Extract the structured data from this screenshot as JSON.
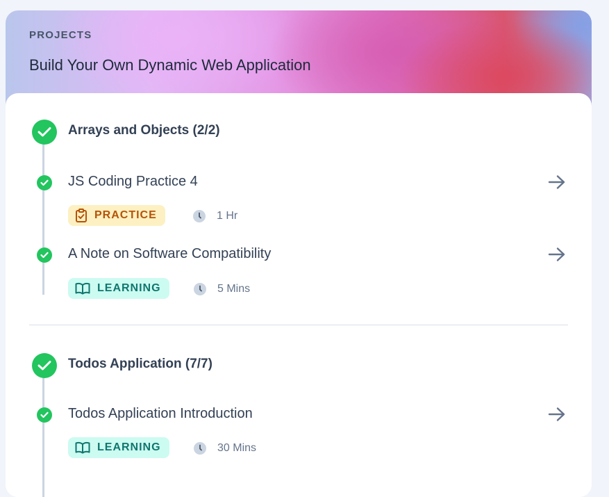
{
  "header": {
    "eyebrow": "PROJECTS",
    "title": "Build Your Own Dynamic Web Application"
  },
  "sections": [
    {
      "title": "Arrays and Objects (2/2)",
      "items": [
        {
          "title": "JS Coding Practice 4",
          "type": "PRACTICE",
          "duration": "1 Hr"
        },
        {
          "title": "A Note on Software Compatibility",
          "type": "LEARNING",
          "duration": "5 Mins"
        }
      ]
    },
    {
      "title": "Todos Application (7/7)",
      "items": [
        {
          "title": "Todos Application Introduction",
          "type": "LEARNING",
          "duration": "30 Mins"
        }
      ]
    }
  ],
  "colors": {
    "check": "#22c55e",
    "practice_bg": "#fdf0c2",
    "practice_fg": "#b45309",
    "learning_bg": "#ccfbf1",
    "learning_fg": "#0f766e"
  },
  "icons": {
    "check": "check-icon",
    "arrow": "arrow-right-icon",
    "clock": "clock-icon",
    "practice": "clipboard-check-icon",
    "learning": "book-open-icon"
  }
}
